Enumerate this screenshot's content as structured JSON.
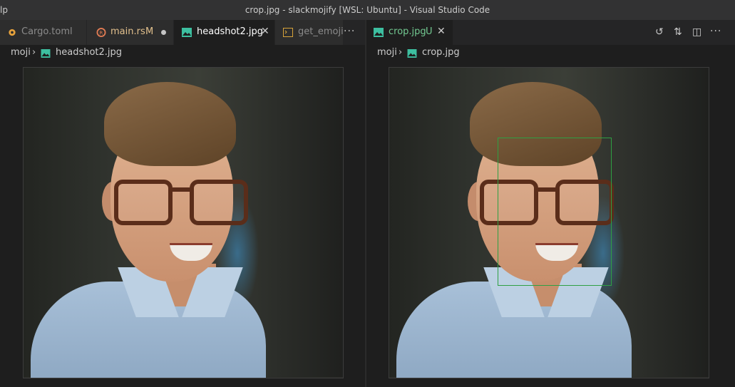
{
  "window": {
    "title": "crop.jpg - slackmojify [WSL: Ubuntu] - Visual Studio Code",
    "menu_fragment": "lp"
  },
  "left_pane": {
    "tabs": [
      {
        "label": "Cargo.toml",
        "icon": "gear-icon",
        "active": false
      },
      {
        "label": "main.rs",
        "mark": "M",
        "icon": "rust-icon",
        "active": false,
        "modified": true
      },
      {
        "label": "headshot2.jpg",
        "icon": "image-icon",
        "active": true
      },
      {
        "label": "get_emoji",
        "icon": "terminal-icon",
        "active": false
      }
    ],
    "overflow": "···",
    "breadcrumb": {
      "folder": "moji",
      "file": "headshot2.jpg"
    }
  },
  "right_pane": {
    "tabs": [
      {
        "label": "crop.jpg",
        "mark": "U",
        "icon": "image-icon",
        "active": true
      }
    ],
    "actions": [
      "history-icon",
      "compare-icon",
      "split-editor-icon",
      "more-icon"
    ],
    "overflow": "···",
    "breadcrumb": {
      "folder": "moji",
      "file": "crop.jpg"
    }
  },
  "colors": {
    "accent_green": "#2ea043",
    "image_icon": "#3dbfa0",
    "modified": "#e2c08d"
  }
}
